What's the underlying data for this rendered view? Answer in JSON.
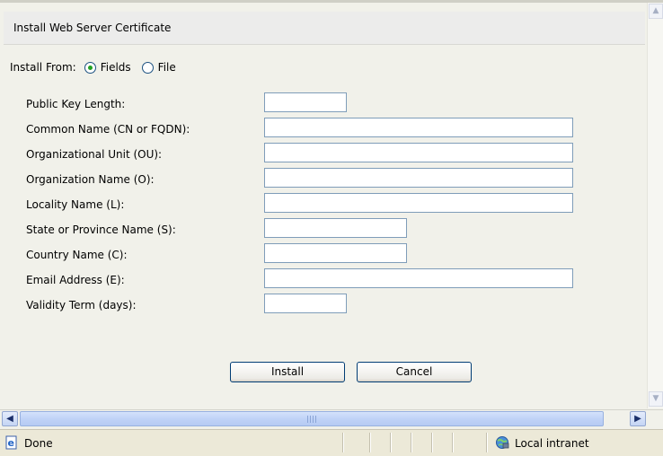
{
  "panel": {
    "title": "Install Web Server Certificate"
  },
  "install_from": {
    "label": "Install From:",
    "options": [
      {
        "label": "Fields",
        "selected": true
      },
      {
        "label": "File",
        "selected": false
      }
    ]
  },
  "form": {
    "fields": [
      {
        "label": "Public Key Length:",
        "value": ""
      },
      {
        "label": "Common Name (CN or FQDN):",
        "value": ""
      },
      {
        "label": "Organizational Unit (OU):",
        "value": ""
      },
      {
        "label": "Organization Name (O):",
        "value": ""
      },
      {
        "label": "Locality Name (L):",
        "value": ""
      },
      {
        "label": "State or Province Name (S):",
        "value": ""
      },
      {
        "label": "Country Name (C):",
        "value": ""
      },
      {
        "label": "Email Address (E):",
        "value": ""
      },
      {
        "label": "Validity Term (days):",
        "value": ""
      }
    ]
  },
  "buttons": {
    "install": "Install",
    "cancel": "Cancel"
  },
  "statusbar": {
    "status": "Done",
    "zone": "Local intranet"
  },
  "icons": {
    "page": "ie-page-icon",
    "zone": "local-intranet-icon",
    "scroll_left": "scroll-left-arrow-icon",
    "scroll_right": "scroll-right-arrow-icon",
    "scroll_up": "scroll-up-arrow-icon",
    "scroll_down": "scroll-down-arrow-icon"
  },
  "colors": {
    "content_bg": "#f1f1ea",
    "input_border": "#7f9db9",
    "button_border": "#003c74",
    "radio_dot": "#21a121",
    "scrollbar_thumb": "#c0d3f7"
  }
}
